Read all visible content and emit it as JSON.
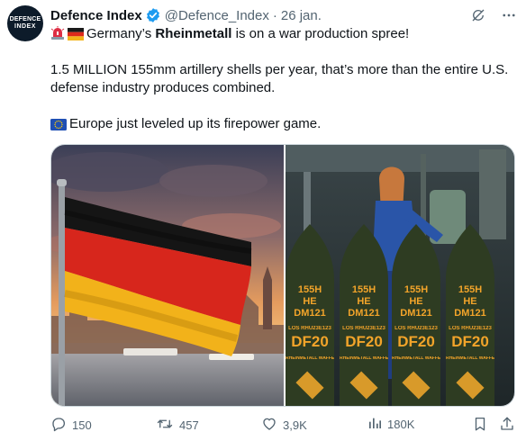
{
  "author": {
    "name": "Defence Index",
    "handle": "@Defence_Index",
    "separator": "·",
    "date": "26 jan.",
    "avatar_line1": "DEFENCE",
    "avatar_line2": "INDEX"
  },
  "post": {
    "line1_before": "Germany’s ",
    "line1_bold": "Rheinmetall",
    "line1_after": " is on a war production spree!",
    "line2": "1.5 MILLION 155mm artillery shells per year, that’s more than the entire U.S. defense industry produces combined.",
    "line4": "Europe just leveled up its firepower game."
  },
  "shells": [
    {
      "caliber": "155H",
      "type": "HE",
      "model": "DM121",
      "code": "DF20",
      "lot": "LOS RHU23E123",
      "maker": "RHEINMETALL WAFFE MUNITION GESCHOSS"
    },
    {
      "caliber": "155H",
      "type": "HE",
      "model": "DM121",
      "code": "DF20",
      "lot": "LOS RHU23E123",
      "maker": "RHEINMETALL WAFFE MUNITION GESCHOSS"
    },
    {
      "caliber": "155H",
      "type": "HE",
      "model": "DM121",
      "code": "DF20",
      "lot": "LOS RHU23E123",
      "maker": "RHEINMETALL WAFFE MUNITION GESCHOSS"
    },
    {
      "caliber": "155H",
      "type": "HE",
      "model": "DM121",
      "code": "DF20",
      "lot": "LOS RHU23E123",
      "maker": "RHEINMETALL WAFFE MUNITION GESCHOSS"
    }
  ],
  "actions": {
    "replies": "150",
    "reposts": "457",
    "likes": "3,9K",
    "views": "180K"
  },
  "icons": {
    "verified": "verified-badge-icon",
    "grok": "grok-icon",
    "more": "more-icon",
    "siren": "siren-emoji",
    "de_flag": "german-flag-emoji",
    "eu_flag": "eu-flag-emoji",
    "reply": "reply-icon",
    "repost": "repost-icon",
    "like": "heart-icon",
    "views": "views-icon",
    "bookmark": "bookmark-icon",
    "share": "share-icon"
  },
  "colors": {
    "text": "#0f1419",
    "secondary": "#536471",
    "verified": "#1d9bf0",
    "flag_black": "#1a1a1a",
    "flag_red": "#dd2a1b",
    "flag_gold": "#f3b41a",
    "shell_green": "#2e3c22",
    "shell_text": "#f2a42a"
  }
}
